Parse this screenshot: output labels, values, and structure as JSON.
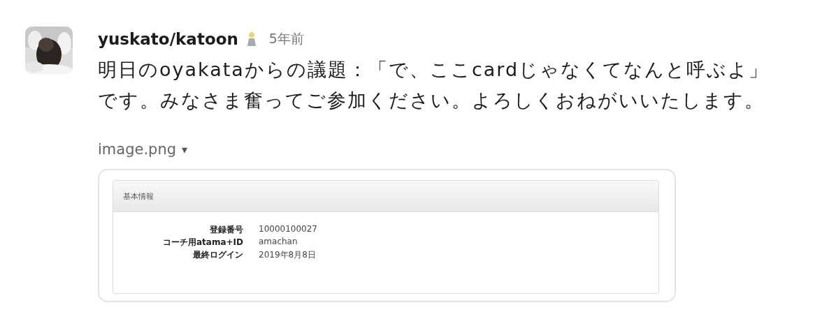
{
  "message": {
    "author": "yuskato/katoon",
    "time": "5年前",
    "lines": [
      "明日のoyakataからの議題：「で、ここcardじゃなくてなんと呼ぶよ」",
      "です。みなさま奮ってご参加ください。よろしくおねがいいたします。"
    ]
  },
  "attachment": {
    "filename": "image.png",
    "toggle": "▾",
    "panel_title": "基本情報",
    "rows": [
      {
        "label": "登録番号",
        "value": "10000100027"
      },
      {
        "label": "コーチ用atama+ID",
        "value": "amachan"
      },
      {
        "label": "最終ログイン",
        "value": "2019年8月8日"
      }
    ]
  }
}
